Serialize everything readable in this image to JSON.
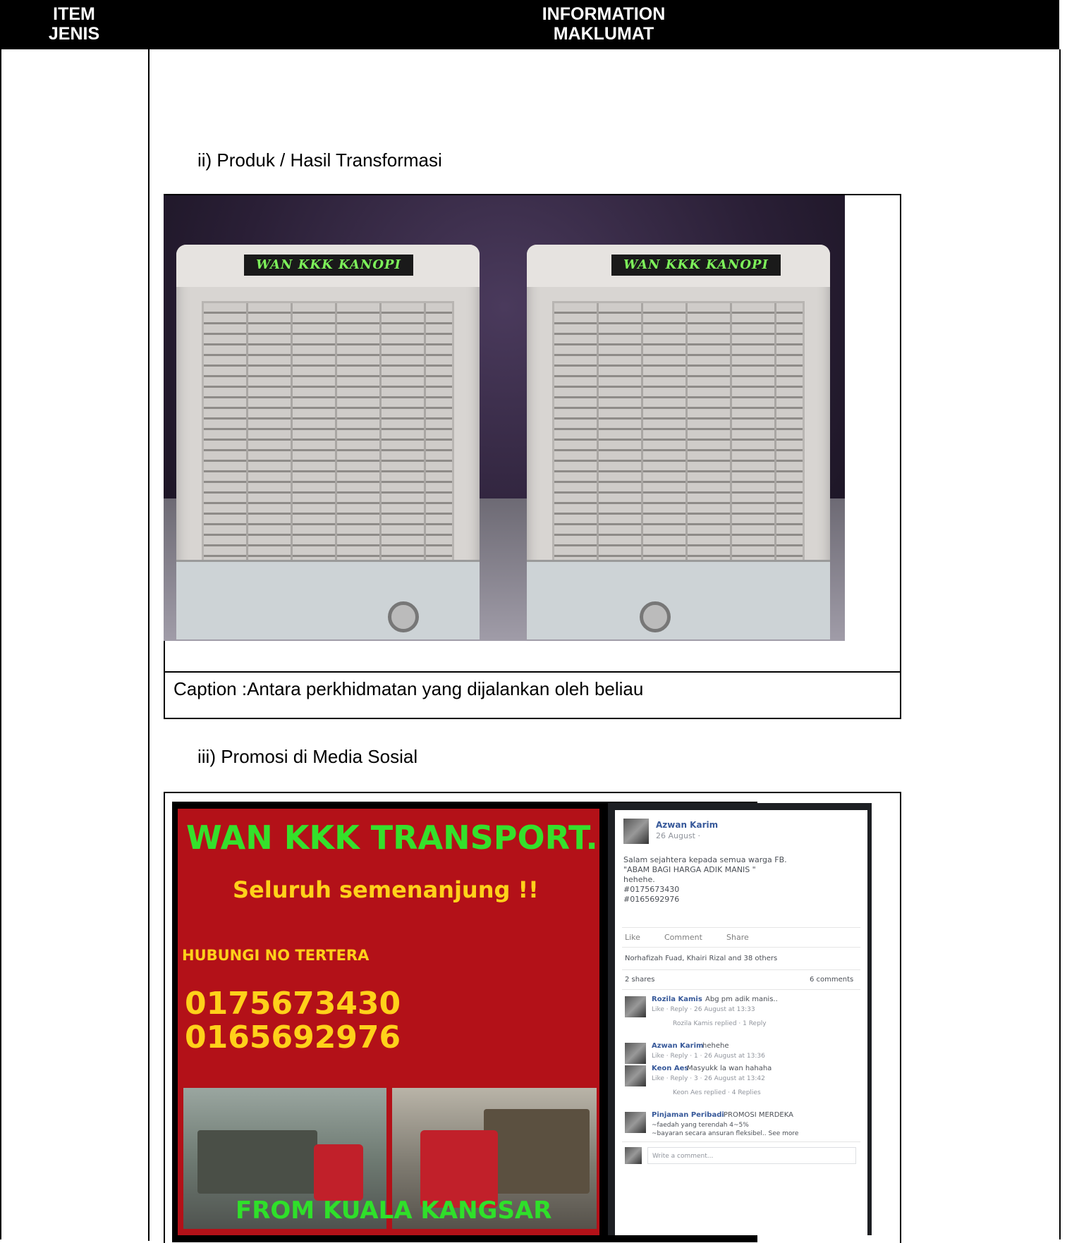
{
  "header": {
    "item_line1": "ITEM",
    "item_line2": "JENIS",
    "info_line1": "INFORMATION",
    "info_line2": "MAKLUMAT"
  },
  "section_ii": {
    "title": "ii)   Produk / Hasil Transformasi"
  },
  "figure1": {
    "cooler_label": "WAN KKK KANOPI",
    "caption": "Caption :Antara perkhidmatan  yang dijalankan oleh beliau"
  },
  "section_iii": {
    "title": "iii)  Promosi di Media Sosial"
  },
  "poster": {
    "title": "WAN KKK TRANSPORT.",
    "subtitle": "Seluruh semenanjung !!",
    "contact_heading": "HUBUNGI NO TERTERA",
    "phone1": "0175673430",
    "phone2": "0165692976",
    "footer": "FROM KUALA KANGSAR"
  },
  "facebook_post": {
    "author": "Azwan Karim",
    "date": "26 August · ",
    "text_lines": [
      "Salam sejahtera kepada semua warga FB.",
      "\"ABAM BAGI HARGA ADIK MANIS \"",
      "hehehe.",
      "#0175673430",
      "#0165692976"
    ],
    "actions": [
      "Like",
      "Comment",
      "Share"
    ],
    "reactions": "Norhafizah Fuad, Khairi Rizal and 38 others",
    "shares": "2 shares",
    "comments_count": "6 comments",
    "comments": [
      {
        "name": "Rozila Kamis",
        "text": "Abg pm adik manis..",
        "meta": "Like · Reply · 26 August at 13:33",
        "reply": "Rozila Kamis replied · 1 Reply"
      },
      {
        "name": "Azwan Karim",
        "text": "hehehe",
        "meta": "Like · Reply · 1 · 26 August at 13:36",
        "reply": ""
      },
      {
        "name": "Keon Aes",
        "text": "Masyukk la wan hahaha",
        "meta": "Like · Reply · 3 · 26 August at 13:42",
        "reply": "Keon Aes replied · 4 Replies"
      },
      {
        "name": "Pinjaman Peribadi",
        "text": "PROMOSI MERDEKA",
        "meta": "~faedah yang terendah 4~5%",
        "reply": "~bayaran secara ansuran fleksibel.. See more"
      }
    ],
    "write_comment": "Write a comment..."
  }
}
